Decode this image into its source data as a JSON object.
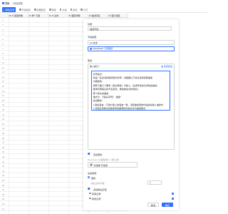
{
  "topbar": {
    "view_label": "表格",
    "add_view_label": "+ 新建视图"
  },
  "toolbar": {
    "add_record": "+ 添加记录",
    "fields": "字段配置",
    "view_config": "视图配置",
    "filter": "筛选",
    "group": "分组",
    "sort": "排序",
    "row_height": "行高"
  },
  "grid": {
    "columns": [
      "AI 造型效果",
      "单个元素",
      "AI 生成",
      "图层详细",
      "描述字段",
      "图片读取"
    ],
    "rows": [
      "1",
      "2",
      "3",
      "4",
      "5",
      "6",
      "7",
      "8",
      "9",
      "10",
      "11",
      "12",
      "13",
      "14",
      "15",
      "16",
      "17",
      "18",
      "19",
      "20",
      "21",
      "22",
      "23",
      "24",
      "25",
      "26",
      "27",
      "28",
      "29",
      "30",
      "31",
      "32",
      "33",
      "34",
      "35",
      "36",
      "37",
      "38",
      "39",
      "40",
      "41"
    ]
  },
  "panel": {
    "title_label": "标题",
    "title_value": "描述字段",
    "field_type_label": "字段类型",
    "field_type_value": "Aa 文本",
    "model_value": "DeepSeek",
    "model_badge": "字段捷径",
    "config_label": "配置",
    "input_command_label": "输入指令 *",
    "use_template": "使用模板",
    "prompt_lines": [
      "背景信息:",
      "你是一名资深的短视频分析师，请根据以下信息完成视频描",
      "述",
      "内容结构：",
      "1.使用“AI描述人像”的",
      "{·镜头组合·}",
      "作为输入依据，生成符合镜头调性",
      "的描述。",
      "2.请严格按“运镜的概述/镜头的运作/",
      "元素等”内容要点",
      "3.结合实际，生成的内容作为视频描述",
      "4.",
      "画面与需求中的",
      "{·设置·}",
      "一致。",
      "5.描述内容需要简洁精准，"
    ],
    "prompt_text": "背景信息:\n你是一名资深的短视频分析师，请根据以下信息完成视频描述\n内容结构：\n按照下面几个要求（镜头概述）为输入，生成符合镜头调性的描述，\n要求写明镜头的节奏变化、角色神态/动作变化；\n每个镜头的描述\n格式为：“【镜头序号】: 描述”\n输出要求：\n1.输出语言：与用户输入的语言一致，请把描述里的作品信息融入描述中\n2.请选出视频中最能体现情绪转折的镜头作为描述重点\n3.输出内容应当连贯流畅并富有情节感",
    "auto_update_label": "自动更新",
    "deepseek_hint": "DeepSeek 大模型能力（限公测）",
    "consumer_label": "请选择 开发者",
    "options_label": "生成选项",
    "radio_label": "随机",
    "tokens_label": "输出文本字数",
    "tokens_value": "1",
    "auto_fill_label": "自动填充空值",
    "checklist": [
      "原有记录",
      "新增记录"
    ],
    "cancel": "取消",
    "confirm": "确定"
  },
  "colors": {
    "accent": "#3370ff"
  }
}
